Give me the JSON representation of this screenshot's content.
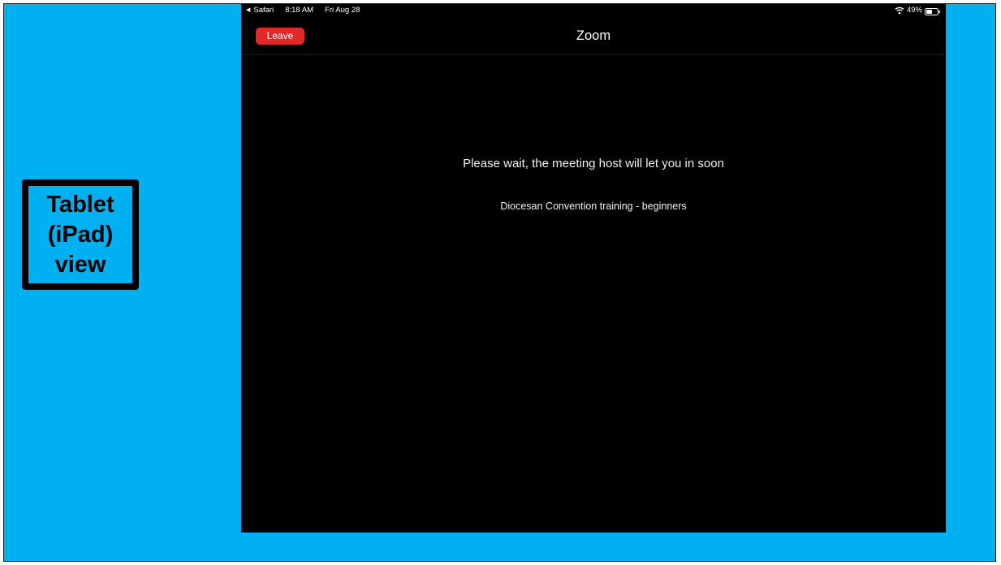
{
  "label": {
    "lines": [
      "Tablet",
      "(iPad)",
      "view"
    ]
  },
  "status_bar": {
    "back_app": "Safari",
    "time": "8:18 AM",
    "date": "Fri Aug 28",
    "battery": "49%",
    "icons": [
      "back-arrow-icon",
      "wifi-icon",
      "battery-icon"
    ]
  },
  "nav": {
    "leave_label": "Leave",
    "title": "Zoom"
  },
  "waiting_room": {
    "message": "Please wait, the meeting host will let you in soon",
    "meeting_name": "Diocesan Convention training - beginners"
  },
  "colors": {
    "slide_background": "#00b0f0",
    "leave_button": "#e02828",
    "ipad_background": "#000000"
  }
}
